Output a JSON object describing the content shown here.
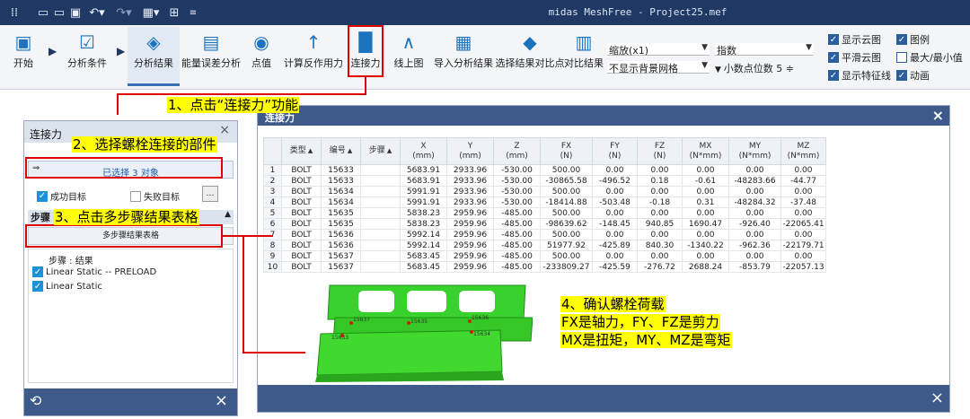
{
  "app": {
    "title": "midas MeshFree - Project25.mef"
  },
  "quick_access": {
    "icons": [
      "app-menu-icon",
      "new-icon",
      "open-icon",
      "save-icon",
      "undo-icon",
      "redo-icon",
      "grid-icon",
      "layout-icon",
      "customize-icon"
    ]
  },
  "ribbon": {
    "buttons": [
      {
        "label": "开始",
        "icon": "start-icon"
      },
      {
        "label": "分析条件",
        "icon": "analysis-condition-icon"
      },
      {
        "label": "分析结果",
        "icon": "analysis-result-icon"
      },
      {
        "label": "能量误差分析",
        "icon": "energy-error-icon"
      },
      {
        "label": "点值",
        "icon": "point-value-icon"
      },
      {
        "label": "计算反作用力",
        "icon": "reaction-force-icon"
      },
      {
        "label": "连接力",
        "icon": "connection-force-icon"
      },
      {
        "label": "线上图",
        "icon": "line-graph-icon"
      },
      {
        "label": "导入分析结果",
        "icon": "import-result-icon"
      },
      {
        "label": "选择结果对比点",
        "icon": "compare-point-icon"
      },
      {
        "label": "对比结果",
        "icon": "compare-result-icon"
      }
    ],
    "scale_select": "缩放(x1)",
    "bg_select": "不显示背景网格",
    "notation_select": "指数",
    "decimal_label": "小数点位数",
    "decimal_value": "5",
    "checks": [
      {
        "label": "显示云图",
        "checked": true
      },
      {
        "label": "图例",
        "checked": true
      },
      {
        "label": "平滑云图",
        "checked": true
      },
      {
        "label": "最大/最小值",
        "checked": false
      },
      {
        "label": "显示特征线",
        "checked": true
      },
      {
        "label": "动画",
        "checked": true
      }
    ]
  },
  "annotations": {
    "step1": "1、点击“连接力”功能",
    "step2": "2、选择螺栓连接的部件",
    "step3": "3、点击多步骤结果表格",
    "step4_title": "4、确认螺栓荷载",
    "step4_line1": "FX是轴力，FY、FZ是剪力",
    "step4_line2": "MX是扭矩，MY、MZ是弯矩"
  },
  "left_panel": {
    "title": "连接力",
    "selected": "已选择 3 对象",
    "success_target": "成功目标",
    "fail_target": "失败目标",
    "step_header": "步骤",
    "multi_step_button": "多步骤结果表格",
    "list_header": "步骤 : 结果",
    "steps": [
      {
        "label": "Linear Static -- PRELOAD",
        "checked": true
      },
      {
        "label": "Linear Static",
        "checked": true
      }
    ]
  },
  "table_window": {
    "title": "连接力",
    "columns": [
      "",
      "类型",
      "编号",
      "步骤",
      "X\n(mm)",
      "Y\n(mm)",
      "Z\n(mm)",
      "FX\n(N)",
      "FY\n(N)",
      "FZ\n(N)",
      "MX\n(N*mm)",
      "MY\n(N*mm)",
      "MZ\n(N*mm)"
    ],
    "rows": [
      [
        "1",
        "BOLT",
        "15633",
        "",
        "5683.91",
        "2933.96",
        "-530.00",
        "500.00",
        "0.00",
        "0.00",
        "0.00",
        "0.00",
        "0.00"
      ],
      [
        "2",
        "BOLT",
        "15633",
        "",
        "5683.91",
        "2933.96",
        "-530.00",
        "-30865.58",
        "-496.52",
        "0.18",
        "-0.61",
        "-48283.66",
        "-44.77"
      ],
      [
        "3",
        "BOLT",
        "15634",
        "",
        "5991.91",
        "2933.96",
        "-530.00",
        "500.00",
        "0.00",
        "0.00",
        "0.00",
        "0.00",
        "0.00"
      ],
      [
        "4",
        "BOLT",
        "15634",
        "",
        "5991.91",
        "2933.96",
        "-530.00",
        "-18414.88",
        "-503.48",
        "-0.18",
        "0.31",
        "-48284.32",
        "-37.48"
      ],
      [
        "5",
        "BOLT",
        "15635",
        "",
        "5838.23",
        "2959.96",
        "-485.00",
        "500.00",
        "0.00",
        "0.00",
        "0.00",
        "0.00",
        "0.00"
      ],
      [
        "6",
        "BOLT",
        "15635",
        "",
        "5838.23",
        "2959.96",
        "-485.00",
        "-98639.62",
        "-148.45",
        "940.85",
        "1690.47",
        "-926.40",
        "-22065.41"
      ],
      [
        "7",
        "BOLT",
        "15636",
        "",
        "5992.14",
        "2959.96",
        "-485.00",
        "500.00",
        "0.00",
        "0.00",
        "0.00",
        "0.00",
        "0.00"
      ],
      [
        "8",
        "BOLT",
        "15636",
        "",
        "5992.14",
        "2959.96",
        "-485.00",
        "51977.92",
        "-425.89",
        "840.30",
        "-1340.22",
        "-962.36",
        "-22179.71"
      ],
      [
        "9",
        "BOLT",
        "15637",
        "",
        "5683.45",
        "2959.96",
        "-485.00",
        "500.00",
        "0.00",
        "0.00",
        "0.00",
        "0.00",
        "0.00"
      ],
      [
        "10",
        "BOLT",
        "15637",
        "",
        "5683.45",
        "2959.96",
        "-485.00",
        "-233809.27",
        "-425.59",
        "-276.72",
        "2688.24",
        "-853.79",
        "-22057.13"
      ]
    ]
  },
  "model": {
    "bolt_labels": [
      "15633",
      "15634",
      "15635",
      "15636",
      "15637"
    ]
  }
}
